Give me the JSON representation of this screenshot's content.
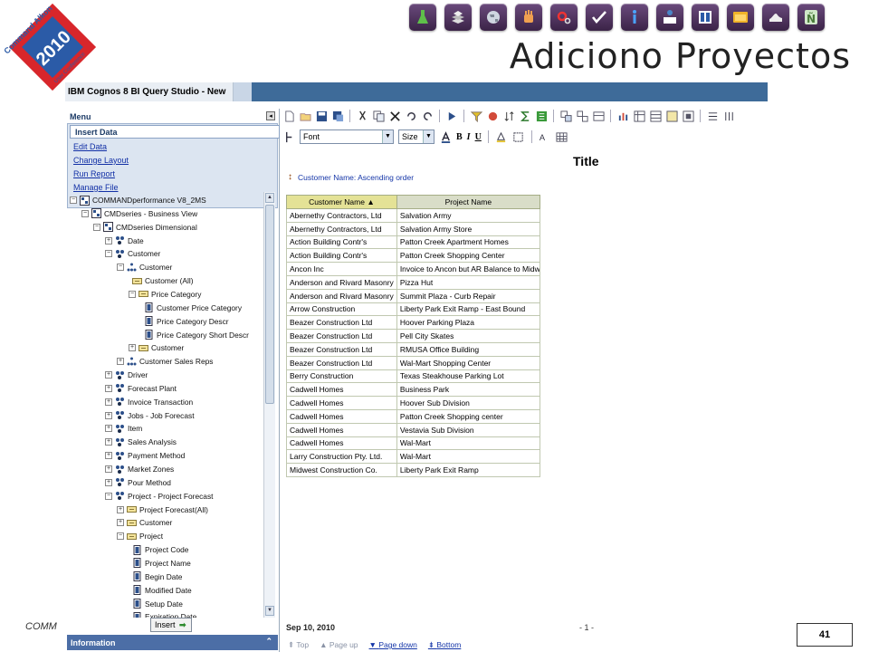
{
  "slide": {
    "title": "Adiciono Proyectos",
    "footer_text": "COMM",
    "page_number": "41",
    "logo": {
      "line1": "Command Alkon",
      "year": "2010",
      "tag": "User Conference"
    }
  },
  "nav_icons": [
    "flask-icon",
    "layers-icon",
    "globe-icon",
    "hand-icon",
    "gear-icon",
    "checkmark-icon",
    "info-icon",
    "org-chart-icon",
    "panels-icon",
    "window-icon",
    "shoe-icon",
    "n-tilde-icon"
  ],
  "app": {
    "window_title": "IBM Cognos 8 BI Query Studio  - New",
    "menu_label": "Menu",
    "menu_items": [
      "Insert Data",
      "Edit Data",
      "Change Layout",
      "Run Report",
      "Manage File"
    ],
    "tree": [
      {
        "label": "COMMANDperformance V8_2MS",
        "level": 0,
        "exp": "-",
        "icon": "package"
      },
      {
        "label": "CMDseries - Business View",
        "level": 1,
        "exp": "-",
        "icon": "package"
      },
      {
        "label": "CMDseries Dimensional",
        "level": 2,
        "exp": "-",
        "icon": "package"
      },
      {
        "label": "Date",
        "level": 3,
        "exp": "+",
        "icon": "dimension"
      },
      {
        "label": "Customer",
        "level": 3,
        "exp": "-",
        "icon": "dimension"
      },
      {
        "label": "Customer",
        "level": 4,
        "exp": "-",
        "icon": "hierarchy"
      },
      {
        "label": "Customer (All)",
        "level": 5,
        "exp": "",
        "icon": "level"
      },
      {
        "label": "Price Category",
        "level": 5,
        "exp": "-",
        "icon": "level"
      },
      {
        "label": "Customer Price Category",
        "level": 6,
        "exp": "",
        "icon": "attribute"
      },
      {
        "label": "Price Category Descr",
        "level": 6,
        "exp": "",
        "icon": "attribute"
      },
      {
        "label": "Price Category Short Descr",
        "level": 6,
        "exp": "",
        "icon": "attribute"
      },
      {
        "label": "Customer",
        "level": 5,
        "exp": "+",
        "icon": "level"
      },
      {
        "label": "Customer Sales Reps",
        "level": 4,
        "exp": "+",
        "icon": "hierarchy"
      },
      {
        "label": "Driver",
        "level": 3,
        "exp": "+",
        "icon": "dimension"
      },
      {
        "label": "Forecast Plant",
        "level": 3,
        "exp": "+",
        "icon": "dimension"
      },
      {
        "label": "Invoice Transaction",
        "level": 3,
        "exp": "+",
        "icon": "dimension"
      },
      {
        "label": "Jobs - Job Forecast",
        "level": 3,
        "exp": "+",
        "icon": "dimension"
      },
      {
        "label": "Item",
        "level": 3,
        "exp": "+",
        "icon": "dimension"
      },
      {
        "label": "Sales Analysis",
        "level": 3,
        "exp": "+",
        "icon": "dimension"
      },
      {
        "label": "Payment Method",
        "level": 3,
        "exp": "+",
        "icon": "dimension"
      },
      {
        "label": "Market Zones",
        "level": 3,
        "exp": "+",
        "icon": "dimension"
      },
      {
        "label": "Pour Method",
        "level": 3,
        "exp": "+",
        "icon": "dimension"
      },
      {
        "label": "Project - Project Forecast",
        "level": 3,
        "exp": "-",
        "icon": "dimension"
      },
      {
        "label": "Project Forecast(All)",
        "level": 4,
        "exp": "+",
        "icon": "level"
      },
      {
        "label": "Customer",
        "level": 4,
        "exp": "+",
        "icon": "level"
      },
      {
        "label": "Project",
        "level": 4,
        "exp": "-",
        "icon": "level"
      },
      {
        "label": "Project Code",
        "level": 5,
        "exp": "",
        "icon": "attribute"
      },
      {
        "label": "Project Name",
        "level": 5,
        "exp": "",
        "icon": "attribute"
      },
      {
        "label": "Begin Date",
        "level": 5,
        "exp": "",
        "icon": "attribute"
      },
      {
        "label": "Modified Date",
        "level": 5,
        "exp": "",
        "icon": "attribute"
      },
      {
        "label": "Setup Date",
        "level": 5,
        "exp": "",
        "icon": "attribute"
      },
      {
        "label": "Expiration Date",
        "level": 5,
        "exp": "",
        "icon": "attribute"
      }
    ],
    "insert_button": "Insert",
    "information_label": "Information",
    "font_select": "Font",
    "size_select": "Size"
  },
  "report": {
    "title": "Title",
    "sort_label": "Customer Name: Ascending order",
    "columns": [
      "Customer Name",
      "Project Name"
    ],
    "rows": [
      [
        "Abernethy Contractors, Ltd",
        "Salvation Army"
      ],
      [
        "Abernethy Contractors, Ltd",
        "Salvation Army Store"
      ],
      [
        "Action Building Contr's",
        "Patton Creek Apartment Homes"
      ],
      [
        "Action Building Contr's",
        "Patton Creek Shopping Center"
      ],
      [
        "Ancon Inc",
        "Invoice to Ancon but AR Balance to Midwe"
      ],
      [
        "Anderson and Rivard Masonry",
        "Pizza Hut"
      ],
      [
        "Anderson and Rivard Masonry",
        "Summit Plaza - Curb Repair"
      ],
      [
        "Arrow Construction",
        "Liberty Park Exit Ramp - East Bound"
      ],
      [
        "Beazer Construction Ltd",
        "Hoover Parking Plaza"
      ],
      [
        "Beazer Construction Ltd",
        "Pell City Skates"
      ],
      [
        "Beazer Construction Ltd",
        "RMUSA Office Building"
      ],
      [
        "Beazer Construction Ltd",
        "Wal-Mart Shopping Center"
      ],
      [
        "Berry Construction",
        "Texas Steakhouse Parking Lot"
      ],
      [
        "Cadwell Homes",
        "Business Park"
      ],
      [
        "Cadwell Homes",
        "Hoover Sub Division"
      ],
      [
        "Cadwell Homes",
        "Patton Creek Shopping center"
      ],
      [
        "Cadwell Homes",
        "Vestavia Sub Division"
      ],
      [
        "Cadwell Homes",
        "Wal-Mart"
      ],
      [
        "Larry Construction Pty. Ltd.",
        "Wal-Mart"
      ],
      [
        "Midwest Construction Co.",
        "Liberty Park Exit Ramp"
      ]
    ],
    "footer_date": "Sep 10, 2010",
    "footer_page": "- 1 -",
    "nav": {
      "top": "Top",
      "page_up": "Page up",
      "page_down": "Page down",
      "bottom": "Bottom"
    }
  },
  "colors": {
    "app_bar": "#3e6b99",
    "nav_tile": "#4e2f5e",
    "info_bar": "#4c6ea6",
    "header_highlight": "#e4e296"
  }
}
